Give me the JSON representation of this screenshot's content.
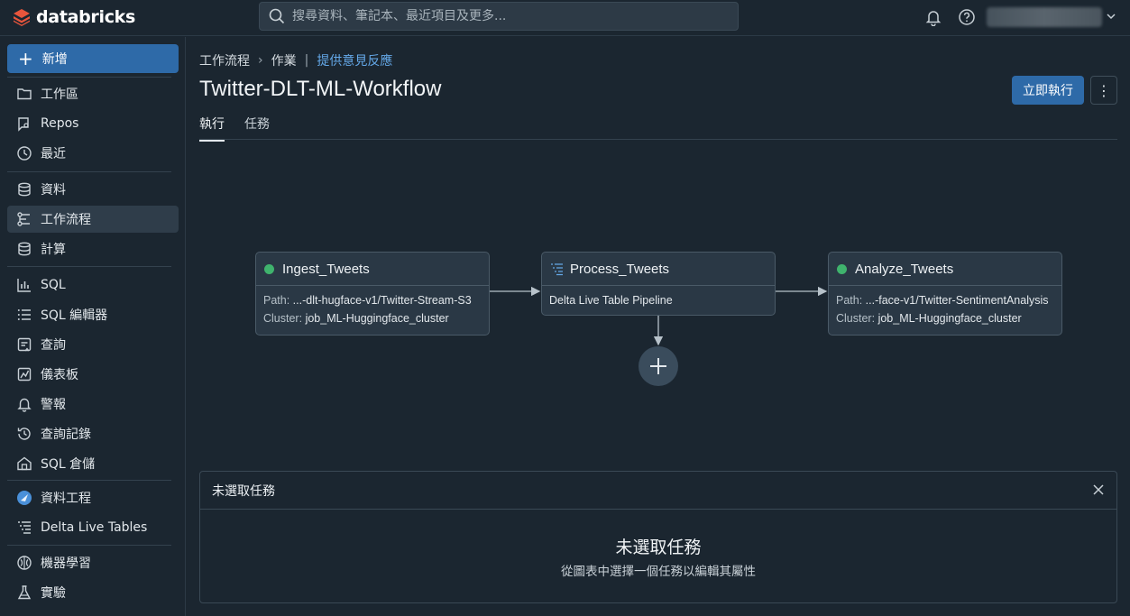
{
  "app": {
    "brand": "databricks"
  },
  "search": {
    "placeholder": "搜尋資料、筆記本、最近項目及更多..."
  },
  "sidebar": {
    "new_label": "新增",
    "items": [
      {
        "label": "工作區",
        "icon": "folder-icon"
      },
      {
        "label": "Repos",
        "icon": "repos-icon"
      },
      {
        "label": "最近",
        "icon": "clock-icon"
      },
      {
        "label": "資料",
        "icon": "database-icon"
      },
      {
        "label": "工作流程",
        "icon": "workflow-icon",
        "active": true
      },
      {
        "label": "計算",
        "icon": "compute-icon"
      },
      {
        "label": "SQL",
        "icon": "bar-chart-icon"
      },
      {
        "label": "SQL 編輯器",
        "icon": "list-icon"
      },
      {
        "label": "查詢",
        "icon": "query-icon"
      },
      {
        "label": "儀表板",
        "icon": "dashboard-icon"
      },
      {
        "label": "警報",
        "icon": "bell-icon"
      },
      {
        "label": "查詢記錄",
        "icon": "history-icon"
      },
      {
        "label": "SQL 倉儲",
        "icon": "warehouse-icon"
      },
      {
        "label": "資料工程",
        "icon": "data-engineering-icon"
      },
      {
        "label": "Delta Live Tables",
        "icon": "dlt-icon"
      },
      {
        "label": "機器學習",
        "icon": "brain-icon"
      },
      {
        "label": "實驗",
        "icon": "flask-icon"
      }
    ]
  },
  "breadcrumb": {
    "root": "工作流程",
    "section": "作業",
    "feedback": "提供意見反應"
  },
  "page": {
    "title": "Twitter-DLT-ML-Workflow",
    "run_label": "立即執行",
    "more_label": "⋮"
  },
  "tabs": [
    "執行",
    "任務"
  ],
  "graph": {
    "tasks": [
      {
        "name": "Ingest_Tweets",
        "path_key": "Path:",
        "path": "...-dlt-hugface-v1/Twitter-Stream-S3",
        "cluster_key": "Cluster:",
        "cluster": "job_ML-Huggingface_cluster",
        "status_color": "#3fb36d"
      },
      {
        "name": "Process_Tweets",
        "detail": "Delta Live Table Pipeline"
      },
      {
        "name": "Analyze_Tweets",
        "path_key": "Path:",
        "path": "...-face-v1/Twitter-SentimentAnalysis",
        "cluster_key": "Cluster:",
        "cluster": "job_ML-Huggingface_cluster",
        "status_color": "#3fb36d"
      }
    ]
  },
  "panel": {
    "header": "未選取任務",
    "title": "未選取任務",
    "subtitle": "從圖表中選擇一個任務以編輯其屬性"
  },
  "colors": {
    "accent": "#2e6aa8",
    "link": "#64a8e8",
    "status_ok": "#3fb36d"
  }
}
